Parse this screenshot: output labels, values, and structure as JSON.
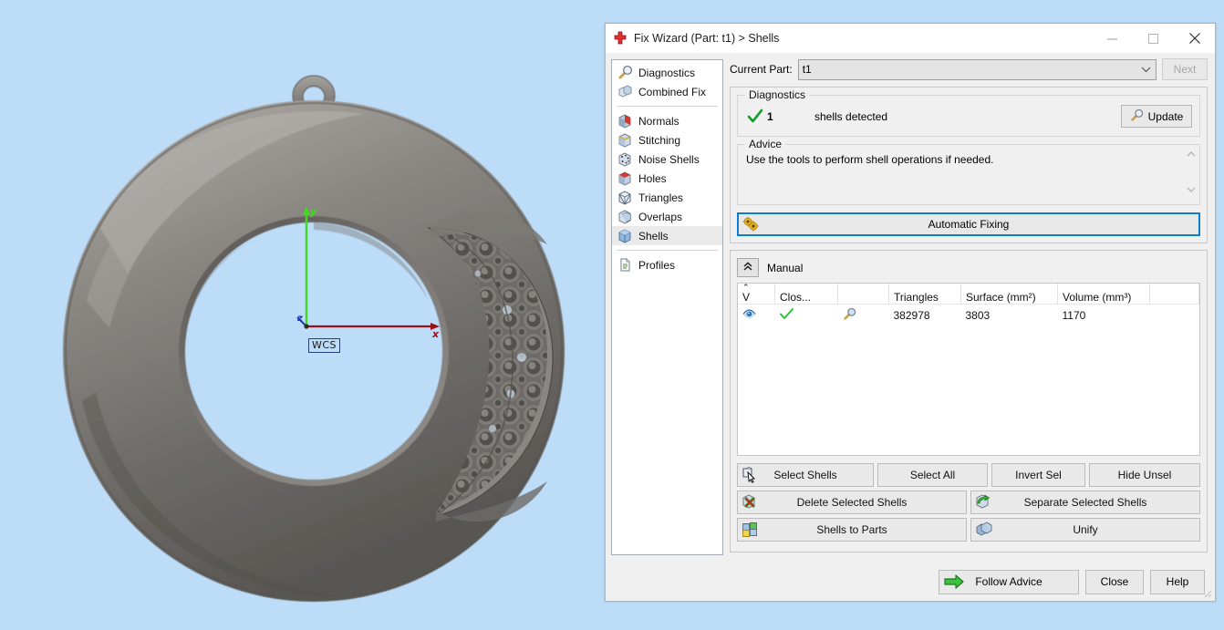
{
  "window": {
    "title": "Fix Wizard (Part: t1) > Shells",
    "icon": "red-cross-icon",
    "controls": {
      "minimize": "–",
      "maximize": "□",
      "close": "✕"
    }
  },
  "sidebar": {
    "groups": [
      {
        "items": [
          {
            "label": "Diagnostics",
            "icon": "magnifier-icon",
            "selected": false
          },
          {
            "label": "Combined Fix",
            "icon": "stacked-cubes-icon",
            "selected": false
          }
        ]
      },
      {
        "items": [
          {
            "label": "Normals",
            "icon": "cube-normals-icon",
            "selected": false
          },
          {
            "label": "Stitching",
            "icon": "cube-stitching-icon",
            "selected": false
          },
          {
            "label": "Noise Shells",
            "icon": "cube-noise-icon",
            "selected": false
          },
          {
            "label": "Holes",
            "icon": "cube-holes-icon",
            "selected": false
          },
          {
            "label": "Triangles",
            "icon": "cube-triangles-icon",
            "selected": false
          },
          {
            "label": "Overlaps",
            "icon": "cube-overlaps-icon",
            "selected": false
          },
          {
            "label": "Shells",
            "icon": "cube-shells-icon",
            "selected": true
          }
        ]
      },
      {
        "items": [
          {
            "label": "Profiles",
            "icon": "document-icon",
            "selected": false
          }
        ]
      }
    ]
  },
  "part": {
    "label": "Current Part:",
    "value": "t1",
    "next_label": "Next"
  },
  "diagnostics": {
    "legend": "Diagnostics",
    "status_icon": "green-check-icon",
    "count": "1",
    "message": "shells detected",
    "update_label": "Update",
    "update_icon": "magnifier-icon"
  },
  "advice": {
    "legend": "Advice",
    "text": "Use the tools to perform shell operations if needed.",
    "scroll_up": "chevron-up-icon",
    "scroll_down": "chevron-down-icon"
  },
  "automatic_fixing": {
    "label": "Automatic Fixing",
    "icon": "gears-icon",
    "focus_color": "#0c7cd5"
  },
  "manual": {
    "title": "Manual",
    "collapse_icon": "double-chevron-up-icon",
    "table": {
      "columns": [
        "V",
        "Clos...",
        "",
        "Triangles",
        "Surface (mm²)",
        "Volume (mm³)",
        ""
      ],
      "sort_column": "V",
      "sort_direction": "ascending",
      "rows": [
        {
          "visible_icon": "eye-icon",
          "closed_icon": "green-check-icon",
          "zoom_icon": "magnifier-icon",
          "triangles": "382978",
          "surface": "3803",
          "volume": "1170"
        }
      ]
    },
    "buttons_row1": [
      {
        "label": "Select Shells",
        "icon": "cursor-select-icon"
      },
      {
        "label": "Select All",
        "icon": ""
      },
      {
        "label": "Invert Sel",
        "icon": ""
      },
      {
        "label": "Hide Unsel",
        "icon": ""
      }
    ],
    "buttons_row2": [
      {
        "label": "Delete Selected Shells",
        "icon": "cube-delete-icon"
      },
      {
        "label": "Separate Selected Shells",
        "icon": "green-arrow-cube-icon"
      }
    ],
    "buttons_row3": [
      {
        "label": "Shells to Parts",
        "icon": "multi-cube-icon"
      },
      {
        "label": "Unify",
        "icon": "merge-cubes-icon"
      }
    ]
  },
  "footer": {
    "follow_advice": {
      "label": "Follow Advice",
      "icon": "green-arrow-right-icon"
    },
    "close": "Close",
    "help": "Help"
  },
  "viewport": {
    "background_color": "#bcdcf7",
    "model_color": "#807d7a",
    "wcs_label": "WCS",
    "axis_x_label": "x",
    "axis_y_label": "y",
    "axis_z_label": "z",
    "axis_x_color": "#9c0f16",
    "axis_y_color": "#3ddb1b",
    "axis_z_color": "#1b39c4"
  }
}
